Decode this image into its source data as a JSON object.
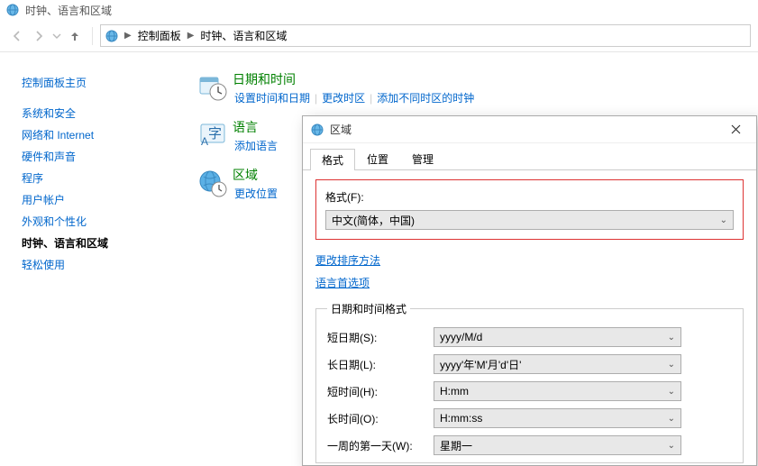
{
  "window": {
    "title": "时钟、语言和区域"
  },
  "breadcrumbs": {
    "root": "控制面板",
    "current": "时钟、语言和区域"
  },
  "sidebar": {
    "home": "控制面板主页",
    "items": [
      {
        "label": "系统和安全",
        "current": false
      },
      {
        "label": "网络和 Internet",
        "current": false
      },
      {
        "label": "硬件和声音",
        "current": false
      },
      {
        "label": "程序",
        "current": false
      },
      {
        "label": "用户帐户",
        "current": false
      },
      {
        "label": "外观和个性化",
        "current": false
      },
      {
        "label": "时钟、语言和区域",
        "current": true
      },
      {
        "label": "轻松使用",
        "current": false
      }
    ]
  },
  "main": {
    "items": [
      {
        "title": "日期和时间",
        "links": [
          "设置时间和日期",
          "更改时区",
          "添加不同时区的时钟"
        ]
      },
      {
        "title": "语言",
        "links": [
          "添加语言"
        ]
      },
      {
        "title": "区域",
        "links": [
          "更改位置"
        ]
      }
    ]
  },
  "dialog": {
    "title": "区域",
    "tabs": [
      "格式",
      "位置",
      "管理"
    ],
    "selected_tab": 0,
    "format_label": "格式(F):",
    "format_value": "中文(简体，中国)",
    "link_sort": "更改排序方法",
    "link_lang": "语言首选项",
    "group_title": "日期和时间格式",
    "rows": [
      {
        "label": "短日期(S):",
        "value": "yyyy/M/d"
      },
      {
        "label": "长日期(L):",
        "value": "yyyy'年'M'月'd'日'"
      },
      {
        "label": "短时间(H):",
        "value": "H:mm"
      },
      {
        "label": "长时间(O):",
        "value": "H:mm:ss"
      },
      {
        "label": "一周的第一天(W):",
        "value": "星期一"
      }
    ]
  }
}
